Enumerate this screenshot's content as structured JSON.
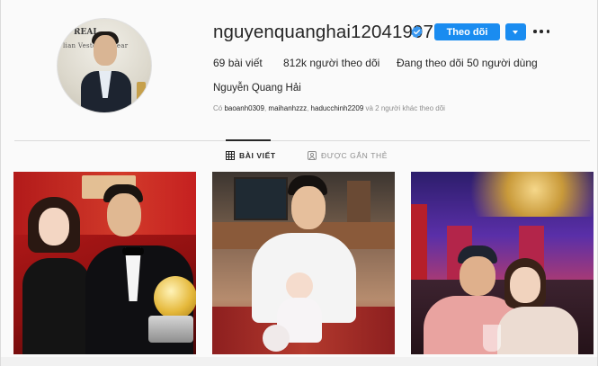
{
  "profile": {
    "username": "nguyenquanghai12041997",
    "verified": true,
    "full_name": "Nguyễn Quang Hải",
    "avatar_text_top": "REAL",
    "avatar_text_banner": "lian Veston   nswear"
  },
  "actions": {
    "follow_label": "Theo dõi",
    "dropdown_icon": "caret-down-icon",
    "more_icon": "more-options-icon"
  },
  "stats": {
    "posts_count": "69",
    "posts_label": " bài viết",
    "followers_count": "812k",
    "followers_label": " người theo dõi",
    "following_prefix": "Đang theo dõi ",
    "following_count": "50",
    "following_label": " người dùng"
  },
  "followed_by": {
    "prefix": "Có ",
    "accounts": [
      "baoanh0309",
      "maihanhzzz",
      "haducchinh2209"
    ],
    "separator": ", ",
    "suffix": " và 2 người khác theo dõi"
  },
  "tabs": [
    {
      "label": "BÀI VIẾT",
      "icon": "grid-icon",
      "active": true
    },
    {
      "label": "ĐƯỢC GẮN THẺ",
      "icon": "tagged-icon",
      "active": false
    }
  ],
  "colors": {
    "accent": "#1a8cf0",
    "verified": "#3897f0",
    "text": "#262626",
    "muted": "#8e8e8e"
  }
}
